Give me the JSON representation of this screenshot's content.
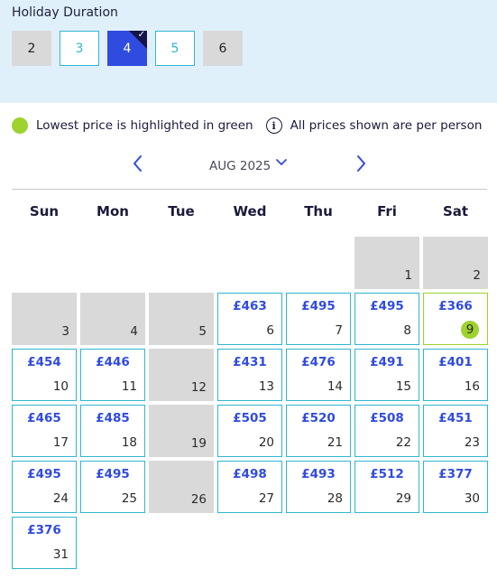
{
  "duration": {
    "title": "Holiday Duration",
    "options": [
      {
        "label": "2",
        "state": "disabled"
      },
      {
        "label": "3",
        "state": "available"
      },
      {
        "label": "4",
        "state": "selected"
      },
      {
        "label": "5",
        "state": "available"
      },
      {
        "label": "6",
        "state": "disabled"
      }
    ]
  },
  "legend": {
    "lowest_text": "Lowest price is highlighted in green",
    "info_glyph": "i",
    "prices_text": "All prices shown are per person"
  },
  "calendar": {
    "month_label": "AUG 2025",
    "weekdays": [
      "Sun",
      "Mon",
      "Tue",
      "Wed",
      "Thu",
      "Fri",
      "Sat"
    ],
    "lowest_color": "#9ed22e",
    "accent_color": "#2f4be0",
    "available_border": "#2fb6d1",
    "days": [
      {
        "day": "1",
        "price": "",
        "state": "na"
      },
      {
        "day": "2",
        "price": "",
        "state": "na"
      },
      {
        "day": "3",
        "price": "",
        "state": "na"
      },
      {
        "day": "4",
        "price": "",
        "state": "na"
      },
      {
        "day": "5",
        "price": "",
        "state": "na"
      },
      {
        "day": "6",
        "price": "£463",
        "state": "av"
      },
      {
        "day": "7",
        "price": "£495",
        "state": "av"
      },
      {
        "day": "8",
        "price": "£495",
        "state": "av"
      },
      {
        "day": "9",
        "price": "£366",
        "state": "low"
      },
      {
        "day": "10",
        "price": "£454",
        "state": "av"
      },
      {
        "day": "11",
        "price": "£446",
        "state": "av"
      },
      {
        "day": "12",
        "price": "",
        "state": "na"
      },
      {
        "day": "13",
        "price": "£431",
        "state": "av"
      },
      {
        "day": "14",
        "price": "£476",
        "state": "av"
      },
      {
        "day": "15",
        "price": "£491",
        "state": "av"
      },
      {
        "day": "16",
        "price": "£401",
        "state": "av"
      },
      {
        "day": "17",
        "price": "£465",
        "state": "av"
      },
      {
        "day": "18",
        "price": "£485",
        "state": "av"
      },
      {
        "day": "19",
        "price": "",
        "state": "na"
      },
      {
        "day": "20",
        "price": "£505",
        "state": "av"
      },
      {
        "day": "21",
        "price": "£520",
        "state": "av"
      },
      {
        "day": "22",
        "price": "£508",
        "state": "av"
      },
      {
        "day": "23",
        "price": "£451",
        "state": "av"
      },
      {
        "day": "24",
        "price": "£495",
        "state": "av"
      },
      {
        "day": "25",
        "price": "£495",
        "state": "av"
      },
      {
        "day": "26",
        "price": "",
        "state": "na"
      },
      {
        "day": "27",
        "price": "£498",
        "state": "av"
      },
      {
        "day": "28",
        "price": "£493",
        "state": "av"
      },
      {
        "day": "29",
        "price": "£512",
        "state": "av"
      },
      {
        "day": "30",
        "price": "£377",
        "state": "av"
      },
      {
        "day": "31",
        "price": "£376",
        "state": "av"
      }
    ]
  }
}
